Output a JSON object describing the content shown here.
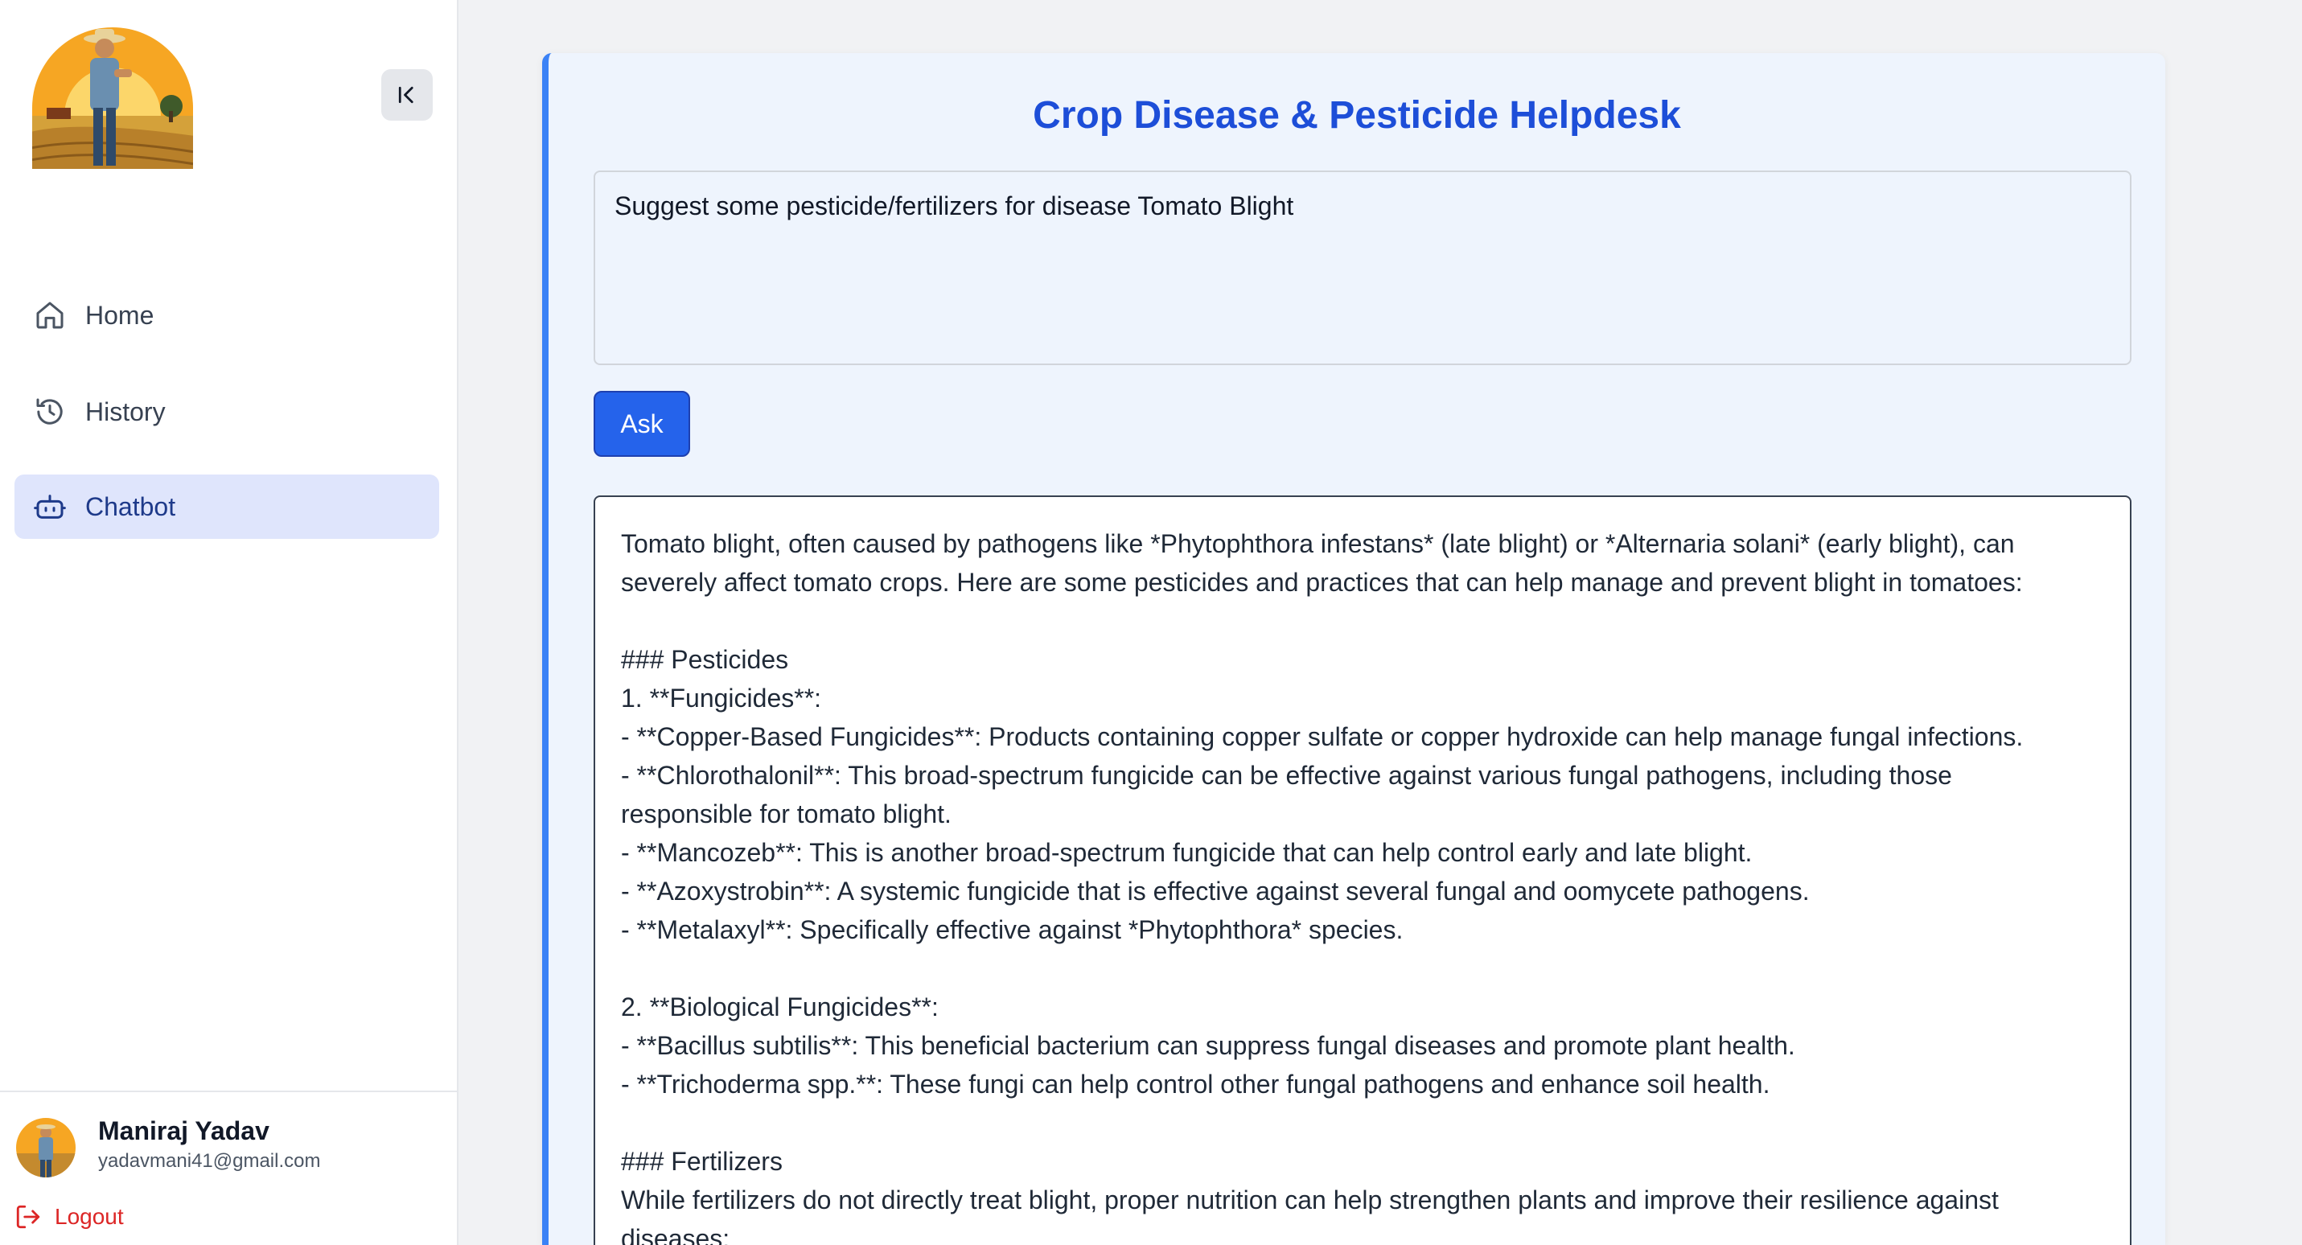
{
  "sidebar": {
    "nav": [
      {
        "label": "Home",
        "icon": "home-icon"
      },
      {
        "label": "History",
        "icon": "history-icon"
      },
      {
        "label": "Chatbot",
        "icon": "chatbot-icon",
        "active": true
      }
    ],
    "user": {
      "name": "Maniraj Yadav",
      "email": "yadavmani41@gmail.com"
    },
    "logout_label": "Logout"
  },
  "main": {
    "title": "Crop Disease & Pesticide Helpdesk",
    "query": "Suggest some pesticide/fertilizers for disease Tomato Blight",
    "ask_label": "Ask",
    "response_lines": [
      "Tomato blight, often caused by pathogens like *Phytophthora infestans* (late blight) or *Alternaria solani* (early blight), can",
      "severely affect tomato crops. Here are some pesticides and practices that can help manage and prevent blight in tomatoes:",
      "",
      "### Pesticides",
      "1. **Fungicides**:",
      "- **Copper-Based Fungicides**: Products containing copper sulfate or copper hydroxide can help manage fungal infections.",
      "- **Chlorothalonil**: This broad-spectrum fungicide can be effective against various fungal pathogens, including those",
      "responsible for tomato blight.",
      "- **Mancozeb**: This is another broad-spectrum fungicide that can help control early and late blight.",
      "- **Azoxystrobin**: A systemic fungicide that is effective against several fungal and oomycete pathogens.",
      "- **Metalaxyl**: Specifically effective against *Phytophthora* species.",
      "",
      "2. **Biological Fungicides**:",
      "- **Bacillus subtilis**: This beneficial bacterium can suppress fungal diseases and promote plant health.",
      "- **Trichoderma spp.**: These fungi can help control other fungal pathogens and enhance soil health.",
      "",
      "### Fertilizers",
      "While fertilizers do not directly treat blight, proper nutrition can help strengthen plants and improve their resilience against",
      "diseases:"
    ]
  },
  "colors": {
    "accent": "#2563eb",
    "title": "#1d4ed8",
    "active_nav_bg": "#dfe5fc",
    "logout": "#dc2626"
  }
}
